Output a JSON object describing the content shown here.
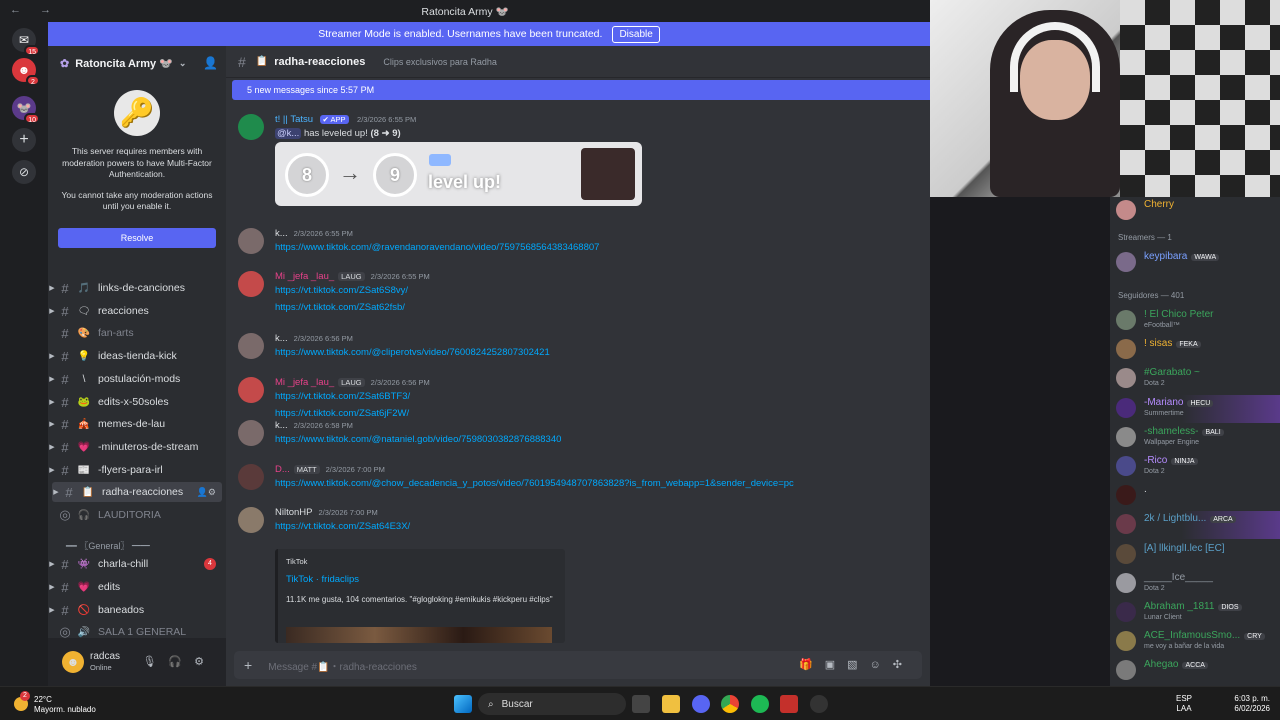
{
  "window": {
    "title": "Ratoncita Army 🐭"
  },
  "rail": {
    "badges": [
      "15",
      "2",
      "10"
    ]
  },
  "banner": {
    "text": "Streamer Mode is enabled. Usernames have been truncated.",
    "button": "Disable"
  },
  "server": {
    "name": "Ratoncita Army 🐭"
  },
  "mfa": {
    "text1": "This server requires members with moderation powers to have Multi-Factor Authentication.",
    "text2": "You cannot take any moderation actions until you enable it.",
    "button": "Resolve"
  },
  "channels": [
    {
      "emoji": "🎵",
      "name": "links-de-canciones"
    },
    {
      "emoji": "🗨",
      "name": "reacciones"
    },
    {
      "emoji": "🎨",
      "name": "fan-arts"
    },
    {
      "emoji": "💡",
      "name": "ideas-tienda-kick"
    },
    {
      "emoji": "\\",
      "name": "postulación-mods"
    },
    {
      "emoji": "🐸",
      "name": "edits-x-50soles"
    },
    {
      "emoji": "🎪",
      "name": "memes-de-lau"
    },
    {
      "emoji": "💗",
      "name": "-minuteros-de-stream"
    },
    {
      "emoji": "📰",
      "name": "-flyers-para-irl"
    },
    {
      "emoji": "📋",
      "name": "radha-reacciones"
    },
    {
      "emoji": "🎧",
      "name": "LAUDITORIA"
    },
    {
      "emoji": "",
      "name": "━━ 〖General〗 ━━"
    },
    {
      "emoji": "👾",
      "name": "charla-chill",
      "badge": "4"
    },
    {
      "emoji": "💗",
      "name": "edits"
    },
    {
      "emoji": "🚫",
      "name": "baneados"
    },
    {
      "emoji": "🔊",
      "name": "SALA 1 GENERAL"
    },
    {
      "emoji": "🔊",
      "name": "SALA 2 GENERAL"
    }
  ],
  "user": {
    "name": "radcas",
    "status": "Online"
  },
  "chat": {
    "channel": "radha-reacciones",
    "topic": "Clips exclusivos para Radha",
    "new_messages": "5 new messages since 5:57 PM",
    "placeholder": "Message #📋・radha-reacciones",
    "messages": [
      {
        "user": "t! || Tatsu",
        "tag": "✔ APP",
        "time": "2/3/2026 6:55 PM",
        "mention": "@k...",
        "text": "has leveled up!",
        "levels": "(8 ➜ 9)",
        "from": "8",
        "to": "9",
        "card": "level up!"
      },
      {
        "user": "k...",
        "time": "2/3/2026 6:55 PM",
        "lines": [
          "https://www.tiktok.com/@ravendanoravendano/video/7597568564383468807"
        ]
      },
      {
        "user": "Mi _jefa _lau_",
        "tag": "LAUG",
        "time": "2/3/2026 6:55 PM",
        "lines": [
          "https://vt.tiktok.com/ZSat6S8vy/",
          "https://vt.tiktok.com/ZSat62fsb/"
        ]
      },
      {
        "user": "k...",
        "time": "2/3/2026 6:56 PM",
        "lines": [
          "https://www.tiktok.com/@cliperotvs/video/7600824252807302421"
        ]
      },
      {
        "user": "Mi _jefa _lau_",
        "tag": "LAUG",
        "time": "2/3/2026 6:56 PM",
        "lines": [
          "https://vt.tiktok.com/ZSat6BTF3/",
          "https://vt.tiktok.com/ZSat6jF2W/"
        ]
      },
      {
        "user": "k...",
        "time": "2/3/2026 6:58 PM",
        "lines": [
          "https://www.tiktok.com/@nataniel.gob/video/7598030382876888340"
        ]
      },
      {
        "user": "D...",
        "tag": "MATT",
        "time": "2/3/2026 7:00 PM",
        "lines": [
          "https://www.tiktok.com/@chow_decadencia_y_potos/video/7601954948707863828?is_from_webapp=1&sender_device=pc"
        ]
      },
      {
        "user": "NiltonHP",
        "time": "2/3/2026 7:00 PM",
        "lines": [
          "https://vt.tiktok.com/ZSat64E3X/"
        ]
      }
    ],
    "embed": {
      "provider": "TikTok",
      "title": "TikTok · fridaclips",
      "desc": "11.1K me gusta, 104 comentarios. \"#glogloking #emikukis #kickperu #clips\""
    }
  },
  "members": {
    "top": {
      "name": "Cherry"
    },
    "groups": [
      {
        "label": "Streamers — 1",
        "list": [
          {
            "name": "keypibara",
            "tag": "WAWA",
            "sub": ""
          }
        ]
      },
      {
        "label": "Seguidores — 401",
        "list": [
          {
            "name": "! El Chico Peter",
            "sub": "eFootball™"
          },
          {
            "name": "! sisas",
            "tag": "FEKA",
            "sub": ""
          },
          {
            "name": "#Garabato ~",
            "sub": "Dota 2"
          },
          {
            "name": "-Mariano",
            "tag": "HECU",
            "sub": "Summertime"
          },
          {
            "name": "-shameless-",
            "tag": "BALI",
            "sub": "Wallpaper Engine"
          },
          {
            "name": "-Rico",
            "tag": "NINJA",
            "sub": "Dota 2"
          },
          {
            "name": ".",
            "sub": ""
          },
          {
            "name": "2k / Lightblu...",
            "tag": "ARCA",
            "sub": ""
          },
          {
            "name": "[A] llkinglI.lec [EC]",
            "sub": ""
          },
          {
            "name": "_____Ice_____",
            "sub": "Dota 2"
          },
          {
            "name": "Abraham _1811",
            "tag": "DIOS",
            "sub": "Lunar Client"
          },
          {
            "name": "ACE_InfamousSmo...",
            "tag": "CRY",
            "sub": "me voy a bañar de la vida"
          },
          {
            "name": "Ahegao",
            "tag": "ACCA",
            "sub": ""
          }
        ]
      }
    ]
  },
  "taskbar": {
    "temp": "22°C",
    "weather": "Mayorm. nublado",
    "search": "Buscar",
    "lang1": "ESP",
    "lang2": "LAA",
    "time": "6:03 p. m.",
    "date": "6/02/2026",
    "notif": "2"
  }
}
